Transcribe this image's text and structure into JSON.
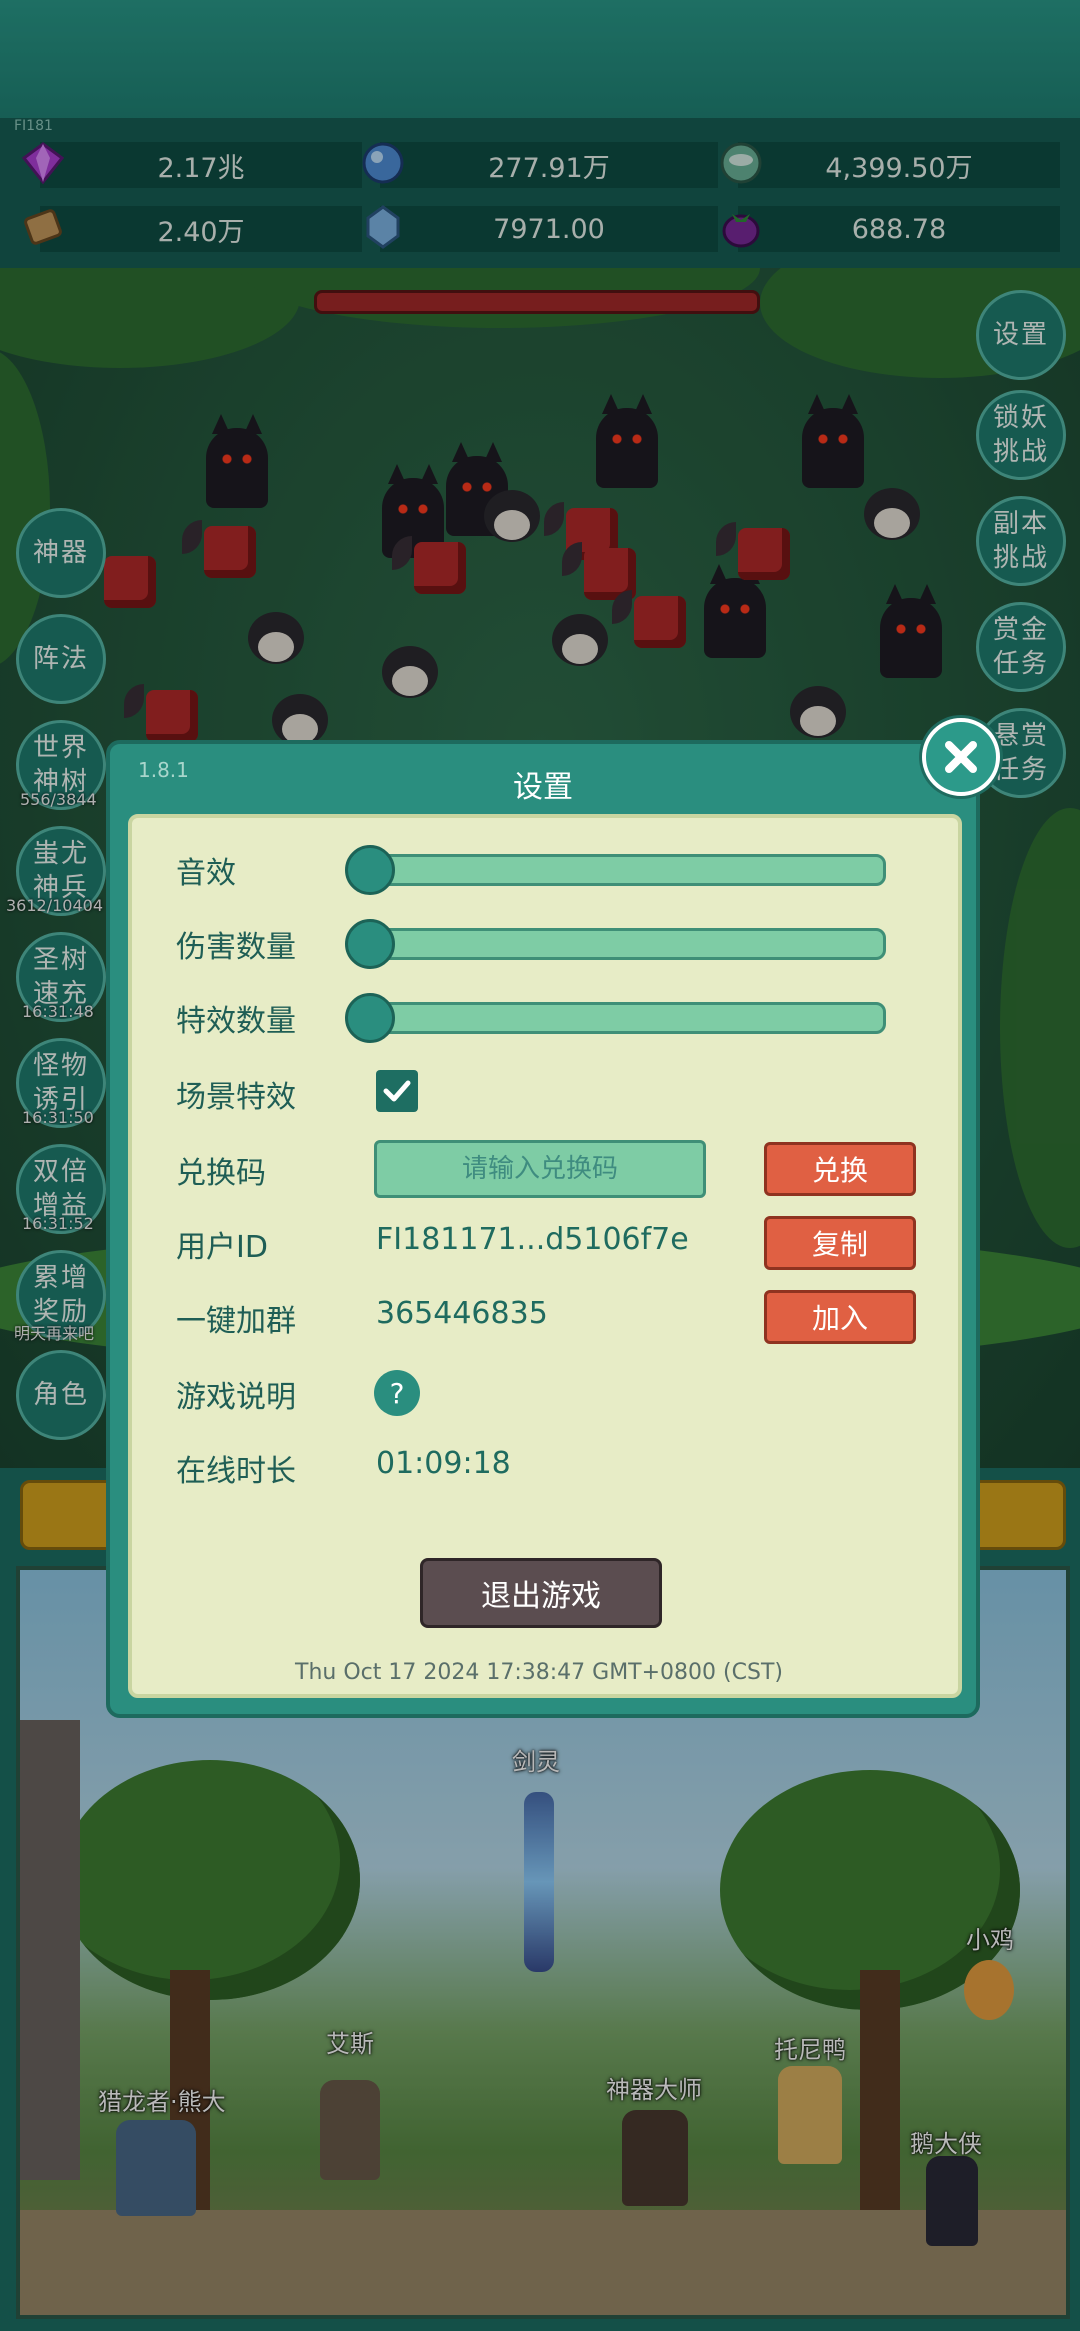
{
  "top_version": "FI181",
  "resources": [
    {
      "icon": "purple-gem-icon",
      "value": "2.17兆"
    },
    {
      "icon": "blue-orb-icon",
      "value": "277.91万"
    },
    {
      "icon": "cloud-orb-icon",
      "value": "4,399.50万"
    },
    {
      "icon": "scroll-icon",
      "value": "2.40万"
    },
    {
      "icon": "ice-crystal-icon",
      "value": "7971.00"
    },
    {
      "icon": "purple-bag-icon",
      "value": "688.78"
    }
  ],
  "left_menu": [
    {
      "label": "神器",
      "sub": ""
    },
    {
      "label": "阵法",
      "sub": ""
    },
    {
      "label": "世界神树",
      "sub": "556/3844"
    },
    {
      "label": "蚩尤神兵",
      "sub": "3612/10404"
    },
    {
      "label": "圣树速充",
      "sub": "16:31:48"
    },
    {
      "label": "怪物诱引",
      "sub": "16:31:50"
    },
    {
      "label": "双倍增益",
      "sub": "16:31:52"
    },
    {
      "label": "累增奖励",
      "sub": "明天再来吧"
    },
    {
      "label": "角色",
      "sub": ""
    }
  ],
  "right_menu": [
    {
      "label": "设置"
    },
    {
      "label": "锁妖挑战"
    },
    {
      "label": "副本挑战"
    },
    {
      "label": "赏金任务"
    },
    {
      "label": "悬赏任务"
    }
  ],
  "dialog": {
    "version": "1.8.1",
    "title": "设置",
    "sound_label": "音效",
    "damage_count_label": "伤害数量",
    "effect_count_label": "特效数量",
    "scene_effect_label": "场景特效",
    "scene_effect_checked": true,
    "redeem_label": "兑换码",
    "redeem_placeholder": "请输入兑换码",
    "redeem_button": "兑换",
    "user_id_label": "用户ID",
    "user_id_value": "FI181171...d5106f7e",
    "copy_button": "复制",
    "join_group_label": "一键加群",
    "join_group_value": "365446835",
    "join_button": "加入",
    "game_help_label": "游戏说明",
    "game_help_icon": "?",
    "online_time_label": "在线时长",
    "online_time_value": "01:09:18",
    "exit_button": "退出游戏",
    "timestamp": "Thu Oct 17 2024 17:38:47 GMT+0800 (CST)"
  },
  "characters": [
    {
      "name": "剑灵"
    },
    {
      "name": "小鸡"
    },
    {
      "name": "艾斯"
    },
    {
      "name": "托尼鸭"
    },
    {
      "name": "猎龙者·熊大"
    },
    {
      "name": "神器大师"
    },
    {
      "name": "鹅大侠"
    }
  ]
}
